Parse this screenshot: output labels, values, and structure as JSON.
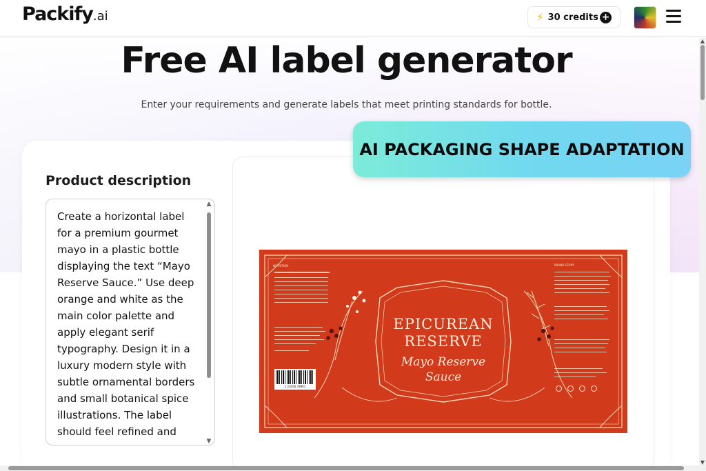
{
  "header": {
    "logo": "Packify",
    "logo_suffix": ".ai",
    "credits_label": "30 credits",
    "credits_icon": "bolt-icon",
    "add_icon": "plus-circle-icon",
    "menu_icon": "hamburger-icon"
  },
  "hero": {
    "title": "Free AI label generator",
    "subtitle": "Enter your requirements and generate labels that meet printing standards for bottle."
  },
  "badge": {
    "text": "AI PACKAGING SHAPE ADAPTATION"
  },
  "form": {
    "title": "Product description",
    "description": "Create a horizontal label for a premium gourmet mayo in a plastic bottle displaying the text “Mayo Reserve Sauce.” Use deep orange and white as the main color palette and apply elegant serif typography. Design it in a luxury modern style with subtle ornamental borders and small botanical spice illustrations. The label should feel refined and"
  },
  "label_preview": {
    "brand_line1": "EPICUREAN",
    "brand_line2": "RESERVE",
    "product_line1": "Mayo Reserve",
    "product_line2": "Sauce",
    "nutrition_heading": "NUTRITION",
    "side_heading": "BRAND STORY",
    "barcode_number": "1 23456 78901",
    "background_color": "#d13a1a",
    "accent_color": "#f9eede"
  },
  "colors": {
    "badge_start": "#7cebd8",
    "badge_end": "#7ad3f5",
    "credits_bolt": "#f2b705"
  }
}
